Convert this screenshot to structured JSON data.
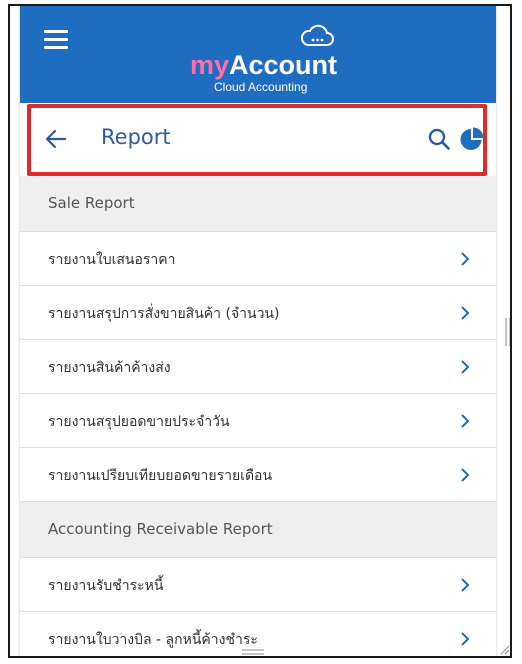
{
  "app": {
    "logo_my": "my",
    "logo_account": "Account",
    "logo_subtitle": "Cloud Accounting",
    "header_color": "#1f6dc0",
    "brand_pink": "#ff6fa5",
    "highlight_color": "#e02a2a"
  },
  "toolbar": {
    "back_icon": "arrow-left-icon",
    "title": "Report",
    "search_icon": "search-icon",
    "chart_icon": "pie-chart-icon"
  },
  "sections": [
    {
      "title": "Sale Report",
      "items": [
        {
          "label": "รายงานใบเสนอราคา"
        },
        {
          "label": "รายงานสรุปการสั่งขายสินค้า (จำนวน)"
        },
        {
          "label": "รายงานสินค้าค้างส่ง"
        },
        {
          "label": "รายงานสรุปยอดขายประจำวัน"
        },
        {
          "label": "รายงานเปรียบเทียบยอดขายรายเดือน"
        }
      ]
    },
    {
      "title": "Accounting Receivable Report",
      "items": [
        {
          "label": "รายงานรับชำระหนี้"
        },
        {
          "label": "รายงานใบวางบิล - ลูกหนี้ค้างชำระ"
        }
      ]
    }
  ]
}
